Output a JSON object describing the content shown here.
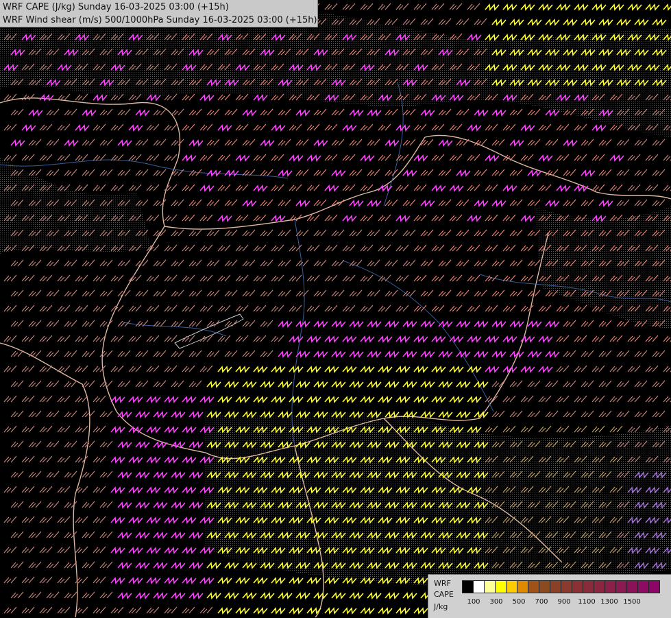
{
  "title": {
    "line1": "WRF CAPE (J/kg) Sunday 16-03-2025 03:00 (+15h)",
    "line2": "WRF Wind shear (m/s) 500/1000hPa Sunday 16-03-2025 03:00 (+15h)"
  },
  "legend": {
    "label_top": "WRF",
    "label_mid": "CAPE",
    "label_unit": "J/kg",
    "colors": [
      "#000000",
      "#ffffff",
      "#ffff99",
      "#ffff00",
      "#ffcc00",
      "#e08a00",
      "#a0521a",
      "#8b4a20",
      "#8b4028",
      "#8b3a2e",
      "#8b3034",
      "#8b2a3a",
      "#8b2540",
      "#8b2048",
      "#8b1a50",
      "#8b1258",
      "#8b0c60",
      "#8b0668"
    ],
    "ticks": [
      "100",
      "300",
      "500",
      "700",
      "900",
      "1100",
      "1300",
      "1500"
    ]
  },
  "shear_colors": {
    "low": "#c8847a",
    "mid": "#f08070",
    "high": "#ff44ff",
    "very_high": "#ffff33",
    "extreme": "#a070d0",
    "tan": "#c8a060"
  }
}
